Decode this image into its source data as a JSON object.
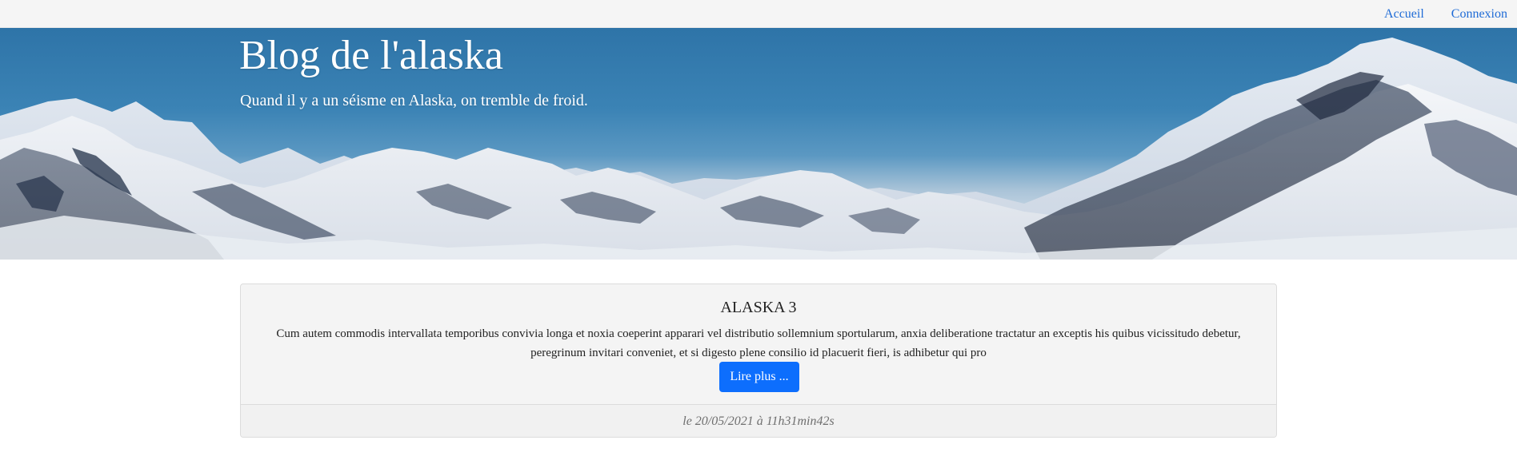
{
  "nav": {
    "items": [
      {
        "label": "Accueil"
      },
      {
        "label": "Connexion"
      }
    ]
  },
  "hero": {
    "title": "Blog de l'alaska",
    "subtitle": "Quand il y a un séisme en Alaska, on tremble de froid."
  },
  "post": {
    "title": "ALASKA 3",
    "excerpt": "Cum autem commodis intervallata temporibus convivia longa et noxia coeperint apparari vel distributio sollemnium sportularum, anxia deliberatione tractatur an exceptis his quibus vicissitudo debetur, peregrinum invitari conveniet, et si digesto plene consilio id placuerit fieri, is adhibetur qui pro",
    "read_more_label": "Lire plus ...",
    "date": "le 20/05/2021 à 11h31min42s"
  },
  "colors": {
    "nav_link": "#1e6bd6",
    "button": "#0d6efd",
    "card_bg": "#f4f4f4"
  }
}
